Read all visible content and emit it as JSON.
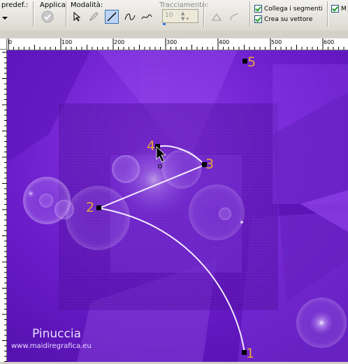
{
  "toolbar": {
    "preset_label": "predef.:",
    "apply_label": "Applica:",
    "mode_label": "Modalità:",
    "tracking_label": "Tracciamento:",
    "tracking_value": "10",
    "link_segments_label": "Collega i segmenti",
    "create_on_vector_label": "Crea su vettore",
    "cut_label": "M"
  },
  "ruler": {
    "labels": [
      "0",
      "100",
      "200",
      "300",
      "400",
      "500",
      "600"
    ]
  },
  "nodes": [
    {
      "label": "1"
    },
    {
      "label": "2"
    },
    {
      "label": "3"
    },
    {
      "label": "4"
    },
    {
      "label": "5"
    }
  ],
  "watermark": {
    "name": "Pinuccia",
    "site": "www.maidiregrafica.eu"
  },
  "colors": {
    "canvas_bg": "#6c1ed0",
    "node_label": "#e8a33a",
    "path_stroke": "#ffffff"
  }
}
